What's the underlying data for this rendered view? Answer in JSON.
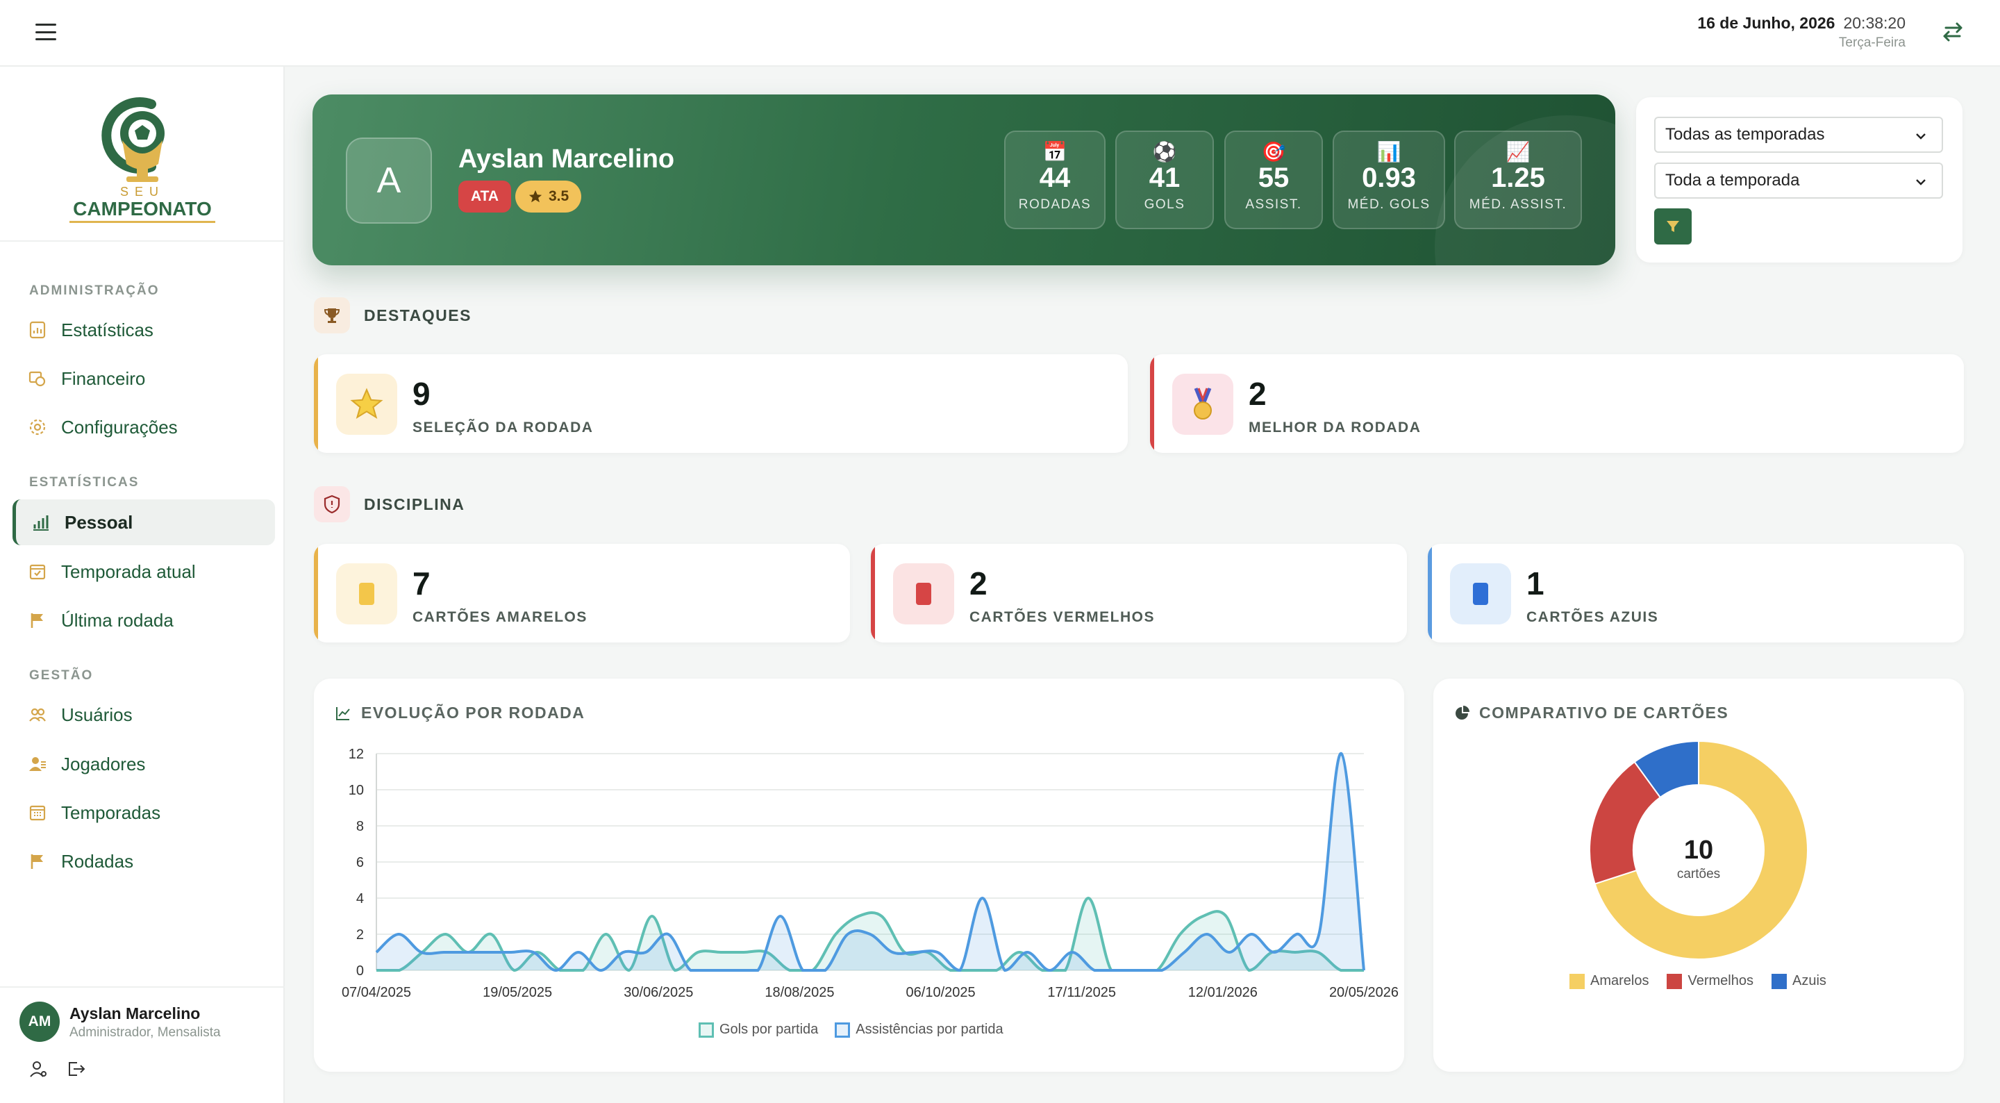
{
  "header": {
    "date": "16 de Junho, 2026",
    "time": "20:38:20",
    "weekday": "Terça-Feira"
  },
  "brand": {
    "line1": "SEU",
    "line2": "CAMPEONATO"
  },
  "sidebar": {
    "sections": [
      {
        "label": "ADMINISTRAÇÃO",
        "items": [
          {
            "label": "Estatísticas",
            "icon": "chart-doc-icon"
          },
          {
            "label": "Financeiro",
            "icon": "money-icon"
          },
          {
            "label": "Configurações",
            "icon": "gear-icon"
          }
        ]
      },
      {
        "label": "ESTATÍSTICAS",
        "items": [
          {
            "label": "Pessoal",
            "icon": "bar-chart-icon",
            "active": true
          },
          {
            "label": "Temporada atual",
            "icon": "calendar-check-icon"
          },
          {
            "label": "Última rodada",
            "icon": "flag-icon"
          }
        ]
      },
      {
        "label": "GESTÃO",
        "items": [
          {
            "label": "Usuários",
            "icon": "users-icon"
          },
          {
            "label": "Jogadores",
            "icon": "players-icon"
          },
          {
            "label": "Temporadas",
            "icon": "calendar-icon"
          },
          {
            "label": "Rodadas",
            "icon": "flag-icon"
          }
        ]
      }
    ],
    "user": {
      "initials": "AM",
      "name": "Ayslan Marcelino",
      "role": "Administrador, Mensalista"
    }
  },
  "player": {
    "initial": "A",
    "name": "Ayslan Marcelino",
    "position": "ATA",
    "rating": "3.5",
    "stats": [
      {
        "icon": "calendar-icon",
        "glyph": "📅",
        "value": "44",
        "label": "RODADAS"
      },
      {
        "icon": "ball-icon",
        "glyph": "⚽",
        "value": "41",
        "label": "GOLS"
      },
      {
        "icon": "target-icon",
        "glyph": "🎯",
        "value": "55",
        "label": "ASSIST."
      },
      {
        "icon": "bar-chart-icon",
        "glyph": "📊",
        "value": "0.93",
        "label": "MÉD. GOLS"
      },
      {
        "icon": "trend-icon",
        "glyph": "📈",
        "value": "1.25",
        "label": "MÉD. ASSIST."
      }
    ]
  },
  "filters": {
    "season": "Todas as temporadas",
    "period": "Toda a temporada"
  },
  "highlights": {
    "title": "DESTAQUES",
    "cards": [
      {
        "value": "9",
        "label": "SELEÇÃO DA RODADA",
        "icon": "star-icon",
        "accent": "#e8b24a"
      },
      {
        "value": "2",
        "label": "MELHOR DA RODADA",
        "icon": "medal-icon",
        "accent": "#d64545"
      }
    ]
  },
  "discipline": {
    "title": "DISCIPLINA",
    "cards": [
      {
        "value": "7",
        "label": "CARTÕES AMARELOS",
        "accent": "#e8b24a",
        "card_color": "#f3c64a",
        "bg": "#fdf3dc"
      },
      {
        "value": "2",
        "label": "CARTÕES VERMELHOS",
        "accent": "#d64545",
        "card_color": "#d64545",
        "bg": "#fbe3e3"
      },
      {
        "value": "1",
        "label": "CARTÕES AZUIS",
        "accent": "#5b9be0",
        "card_color": "#2f6fd6",
        "bg": "#e2eefb"
      }
    ]
  },
  "chart_data": [
    {
      "type": "line",
      "title": "EVOLUÇÃO POR RODADA",
      "ylim": [
        0,
        12
      ],
      "yticks": [
        "0",
        "2",
        "4",
        "6",
        "8",
        "10",
        "12"
      ],
      "xticks": [
        "07/04/2025",
        "19/05/2025",
        "30/06/2025",
        "18/08/2025",
        "06/10/2025",
        "17/11/2025",
        "12/01/2026",
        "20/05/2026"
      ],
      "grid": true,
      "legend": "bottom",
      "series": [
        {
          "name": "Gols por partida",
          "color": "#5fbfb3",
          "values": [
            0,
            0,
            1,
            2,
            1,
            2,
            0,
            1,
            0,
            0,
            2,
            0,
            3,
            0,
            1,
            1,
            1,
            1,
            0,
            0,
            2,
            3,
            3,
            1,
            1,
            0,
            0,
            0,
            1,
            0,
            0,
            4,
            0,
            0,
            0,
            2,
            3,
            3,
            0,
            1,
            1,
            1,
            0,
            0
          ]
        },
        {
          "name": "Assistências por partida",
          "color": "#4e9ae0",
          "values": [
            1,
            2,
            1,
            1,
            1,
            1,
            1,
            1,
            0,
            1,
            0,
            1,
            1,
            2,
            0,
            0,
            0,
            0,
            3,
            0,
            0,
            2,
            2,
            1,
            1,
            1,
            0,
            4,
            0,
            1,
            0,
            1,
            0,
            0,
            0,
            0,
            1,
            2,
            1,
            2,
            1,
            2,
            2,
            12,
            0
          ]
        }
      ]
    },
    {
      "type": "pie",
      "title": "COMPARATIVO DE CARTÕES",
      "center_value": "10",
      "center_label": "cartões",
      "legend": "bottom",
      "categories": [
        "Amarelos",
        "Vermelhos",
        "Azuis"
      ],
      "values": [
        7,
        2,
        1
      ],
      "colors": [
        "#f5cf63",
        "#cc4541",
        "#2f6fc9"
      ]
    }
  ]
}
